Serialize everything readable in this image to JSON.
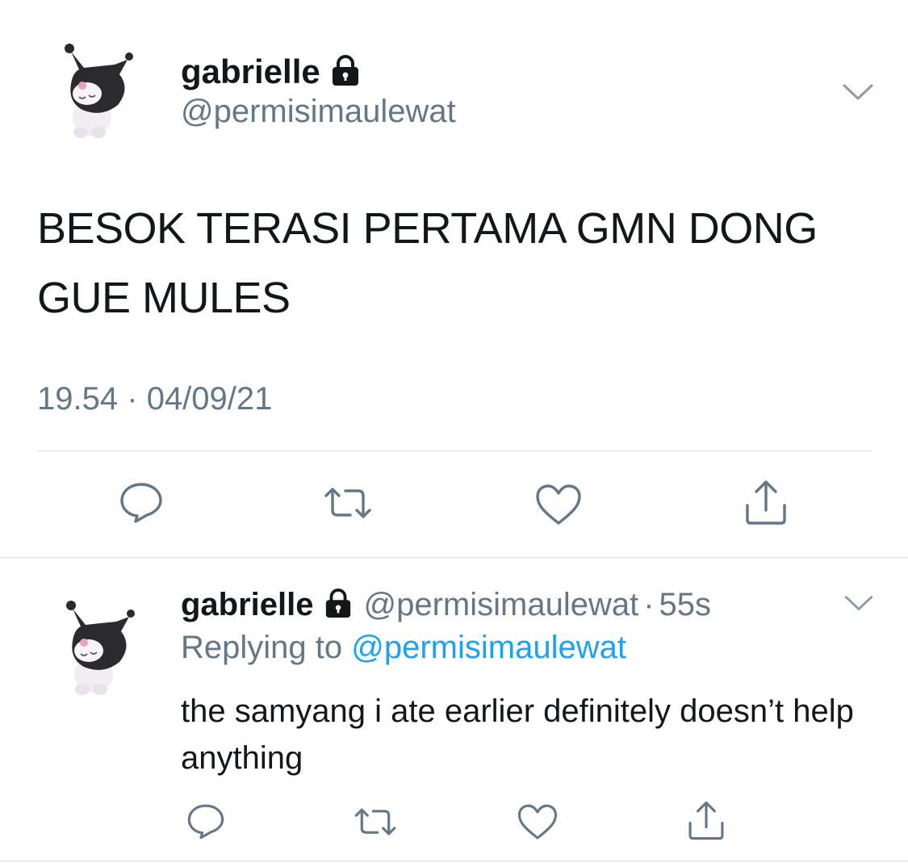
{
  "main_tweet": {
    "display_name": "gabrielle",
    "handle": "@permisimaulewat",
    "text": "BESOK TERASI PERTAMA GMN DONG GUE MULES",
    "time": "19.54",
    "separator": "·",
    "date": "04/09/21",
    "icons": [
      "lock-icon",
      "chevron-down-icon",
      "reply-icon",
      "retweet-icon",
      "like-icon",
      "share-icon"
    ]
  },
  "reply_tweet": {
    "display_name": "gabrielle",
    "handle": "@permisimaulewat",
    "separator": "·",
    "age": "55s",
    "replying_prefix": "Replying to",
    "replying_to": "@permisimaulewat",
    "text": "the samyang i ate earlier definitely doesn’t help anything",
    "icons": [
      "lock-icon",
      "chevron-down-icon",
      "reply-icon",
      "retweet-icon",
      "like-icon",
      "share-icon"
    ]
  },
  "colors": {
    "text": "#14171a",
    "secondary": "#657786",
    "link": "#1da1f2",
    "divider": "#d9dde0"
  }
}
